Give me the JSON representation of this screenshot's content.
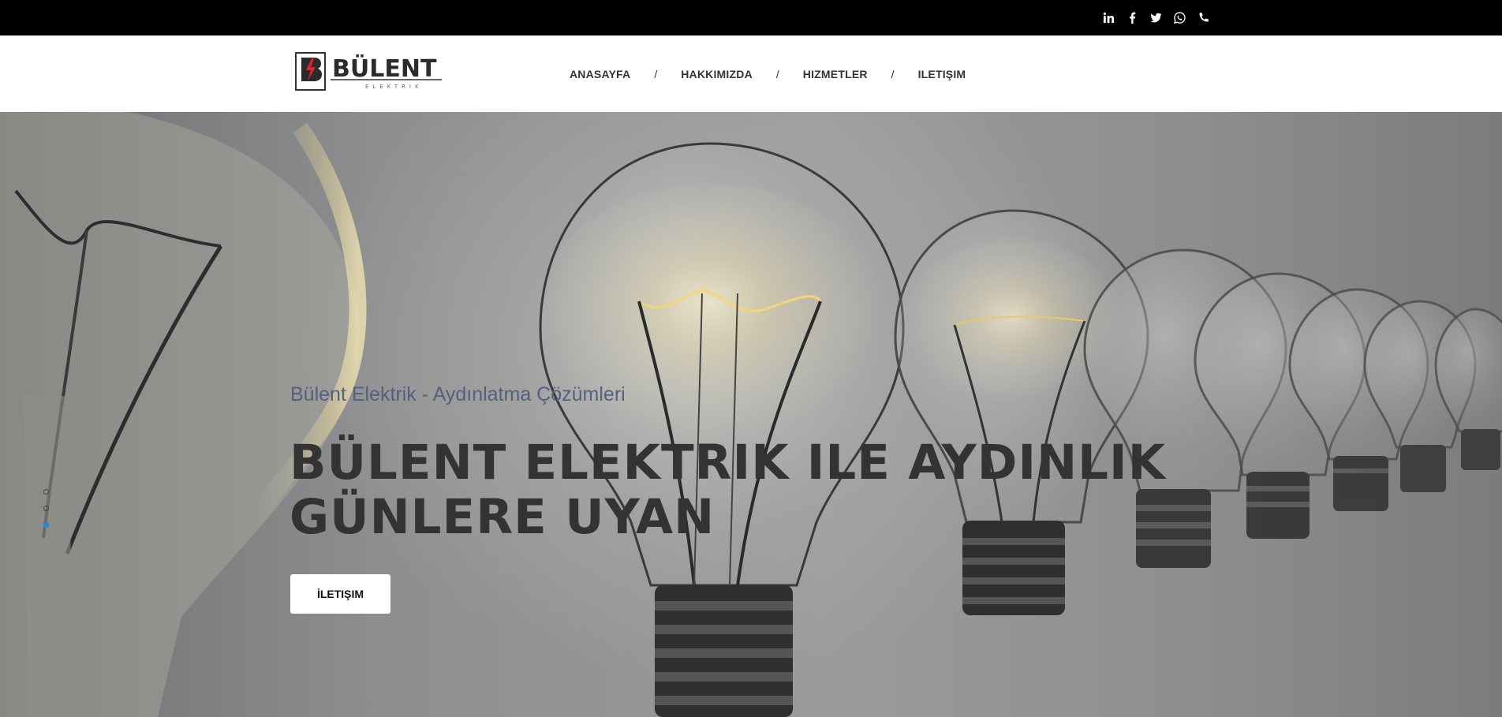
{
  "topbar": {
    "social_icons": [
      "linkedin-icon",
      "facebook-icon",
      "twitter-icon",
      "whatsapp-icon",
      "phone-icon"
    ]
  },
  "header": {
    "logo_text": "BÜLENT",
    "logo_subtext": "ELEKTRIK",
    "nav": [
      {
        "label": "ANASAYFA"
      },
      {
        "label": "HAKKIMIZDA"
      },
      {
        "label": "HIZMETLER"
      },
      {
        "label": "ILETIŞIM"
      }
    ],
    "separator": "/"
  },
  "hero": {
    "kicker": "Bülent Elektrik - Aydınlatma Çözümleri",
    "title": "BÜLENT ELEKTRIK ILE AYDINLIK GÜNLERE UYAN",
    "cta_label": "İLETIŞIM",
    "slider_dots": 3,
    "active_dot": 3
  },
  "colors": {
    "topbar_bg": "#000000",
    "logo_red": "#e0242b",
    "kicker": "#55607d",
    "title": "#333333",
    "active_dot": "#1e88d8"
  }
}
